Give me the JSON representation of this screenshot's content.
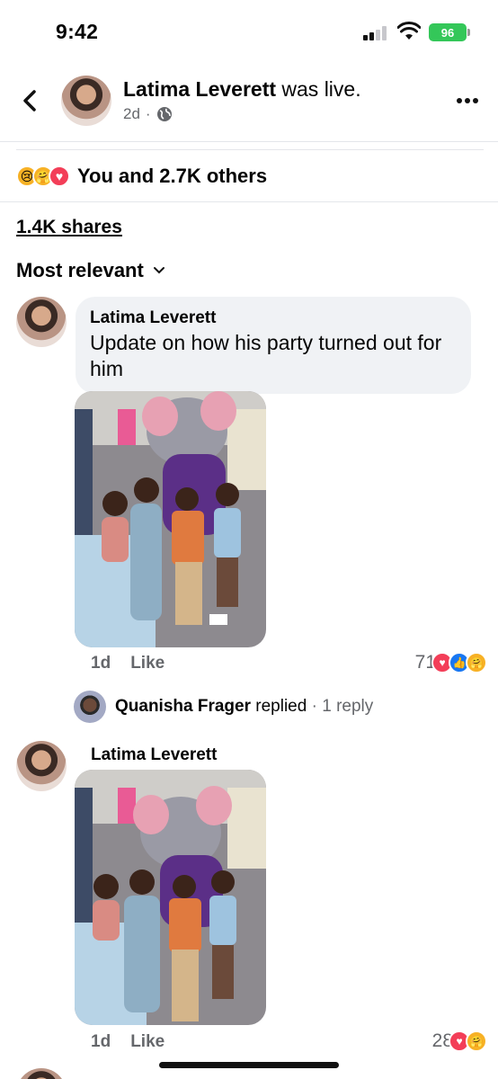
{
  "status_bar": {
    "time": "9:42",
    "battery": "96"
  },
  "header": {
    "name": "Latima Leverett",
    "action": " was live.",
    "time_ago": "2d",
    "separator": "·"
  },
  "reactions": {
    "summary": "You and 2.7K others",
    "icons": [
      "sad",
      "care",
      "love"
    ]
  },
  "shares": "1.4K shares",
  "sort": {
    "label": "Most relevant"
  },
  "comments": [
    {
      "author": "Latima Leverett",
      "text": "Update on how his party turned out for him",
      "time": "1d",
      "like_label": "Like",
      "reaction_count": "71",
      "reaction_icons": [
        "love",
        "like",
        "care"
      ]
    },
    {
      "author": "Latima Leverett",
      "text": "",
      "time": "1d",
      "like_label": "Like",
      "reaction_count": "28",
      "reaction_icons": [
        "love",
        "care"
      ]
    }
  ],
  "reply_summary": {
    "name": "Quanisha Frager",
    "action": "replied",
    "separator": "·",
    "count": "1 reply"
  },
  "colors": {
    "accent": "#1877f2",
    "love": "#f33e58",
    "care": "#f7b125",
    "battery": "#34c759"
  }
}
